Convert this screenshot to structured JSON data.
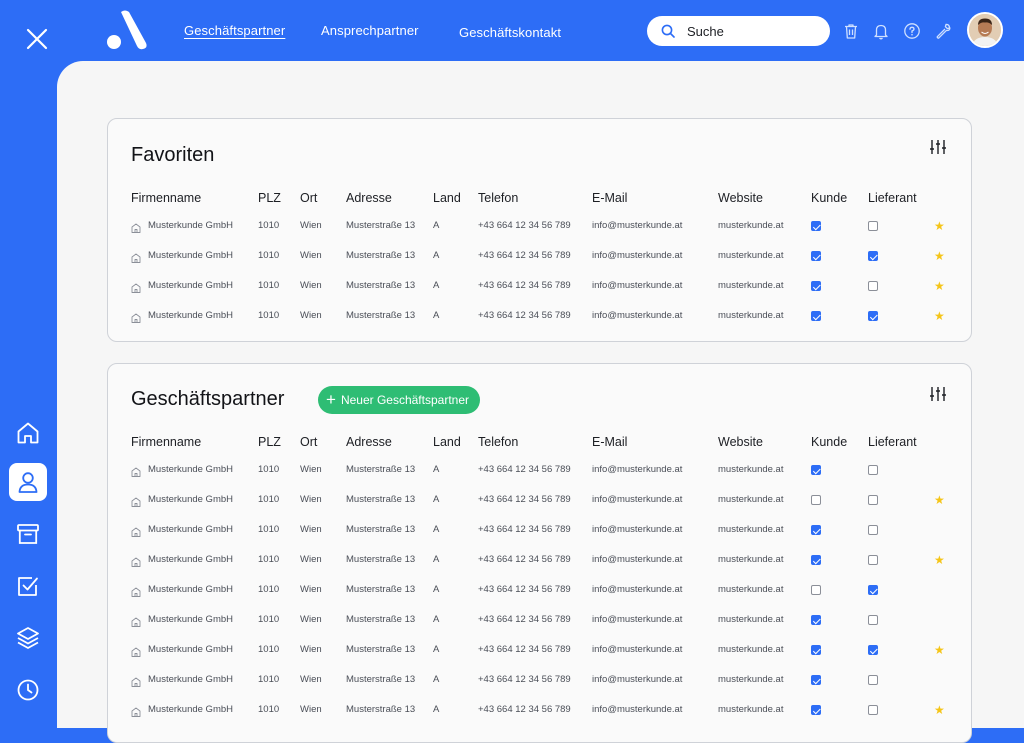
{
  "nav": {
    "links": [
      "Geschäftspartner",
      "Ansprechpartner",
      "Geschäftskontakt"
    ],
    "active": "Geschäftspartner",
    "search_placeholder": "Suche",
    "icons": [
      "trash-icon",
      "bell-icon",
      "help-icon",
      "wrench-icon"
    ]
  },
  "sidebar": {
    "items": [
      "home-icon",
      "user-icon",
      "archive-icon",
      "checkbox-icon",
      "layers-icon",
      "clock-icon"
    ],
    "active": "user-icon"
  },
  "columns": [
    "Firmenname",
    "PLZ",
    "Ort",
    "Adresse",
    "Land",
    "Telefon",
    "E-Mail",
    "Website",
    "Kunde",
    "Lieferant"
  ],
  "favorites": {
    "title": "Favoriten",
    "rows": [
      {
        "name": "Musterkunde GmbH",
        "plz": "1010",
        "ort": "Wien",
        "adresse": "Musterstraße 13",
        "land": "A",
        "telefon": "+43 664 12 34 56 789",
        "email": "info@musterkunde.at",
        "website": "musterkunde.at",
        "kunde": true,
        "lieferant": false,
        "fav": true
      },
      {
        "name": "Musterkunde GmbH",
        "plz": "1010",
        "ort": "Wien",
        "adresse": "Musterstraße 13",
        "land": "A",
        "telefon": "+43 664 12 34 56 789",
        "email": "info@musterkunde.at",
        "website": "musterkunde.at",
        "kunde": true,
        "lieferant": true,
        "fav": true
      },
      {
        "name": "Musterkunde GmbH",
        "plz": "1010",
        "ort": "Wien",
        "adresse": "Musterstraße 13",
        "land": "A",
        "telefon": "+43 664 12 34 56 789",
        "email": "info@musterkunde.at",
        "website": "musterkunde.at",
        "kunde": true,
        "lieferant": false,
        "fav": true
      },
      {
        "name": "Musterkunde GmbH",
        "plz": "1010",
        "ort": "Wien",
        "adresse": "Musterstraße 13",
        "land": "A",
        "telefon": "+43 664 12 34 56 789",
        "email": "info@musterkunde.at",
        "website": "musterkunde.at",
        "kunde": true,
        "lieferant": true,
        "fav": true
      }
    ]
  },
  "partners": {
    "title": "Geschäftspartner",
    "add_label": "Neuer Geschäftspartner",
    "rows": [
      {
        "name": "Musterkunde GmbH",
        "plz": "1010",
        "ort": "Wien",
        "adresse": "Musterstraße 13",
        "land": "A",
        "telefon": "+43 664 12 34 56 789",
        "email": "info@musterkunde.at",
        "website": "musterkunde.at",
        "kunde": true,
        "lieferant": false,
        "fav": false
      },
      {
        "name": "Musterkunde GmbH",
        "plz": "1010",
        "ort": "Wien",
        "adresse": "Musterstraße 13",
        "land": "A",
        "telefon": "+43 664 12 34 56 789",
        "email": "info@musterkunde.at",
        "website": "musterkunde.at",
        "kunde": false,
        "lieferant": false,
        "fav": true
      },
      {
        "name": "Musterkunde GmbH",
        "plz": "1010",
        "ort": "Wien",
        "adresse": "Musterstraße 13",
        "land": "A",
        "telefon": "+43 664 12 34 56 789",
        "email": "info@musterkunde.at",
        "website": "musterkunde.at",
        "kunde": true,
        "lieferant": false,
        "fav": false
      },
      {
        "name": "Musterkunde GmbH",
        "plz": "1010",
        "ort": "Wien",
        "adresse": "Musterstraße 13",
        "land": "A",
        "telefon": "+43 664 12 34 56 789",
        "email": "info@musterkunde.at",
        "website": "musterkunde.at",
        "kunde": true,
        "lieferant": false,
        "fav": true
      },
      {
        "name": "Musterkunde GmbH",
        "plz": "1010",
        "ort": "Wien",
        "adresse": "Musterstraße 13",
        "land": "A",
        "telefon": "+43 664 12 34 56 789",
        "email": "info@musterkunde.at",
        "website": "musterkunde.at",
        "kunde": false,
        "lieferant": true,
        "fav": false
      },
      {
        "name": "Musterkunde GmbH",
        "plz": "1010",
        "ort": "Wien",
        "adresse": "Musterstraße 13",
        "land": "A",
        "telefon": "+43 664 12 34 56 789",
        "email": "info@musterkunde.at",
        "website": "musterkunde.at",
        "kunde": true,
        "lieferant": false,
        "fav": false
      },
      {
        "name": "Musterkunde GmbH",
        "plz": "1010",
        "ort": "Wien",
        "adresse": "Musterstraße 13",
        "land": "A",
        "telefon": "+43 664 12 34 56 789",
        "email": "info@musterkunde.at",
        "website": "musterkunde.at",
        "kunde": true,
        "lieferant": true,
        "fav": true
      },
      {
        "name": "Musterkunde GmbH",
        "plz": "1010",
        "ort": "Wien",
        "adresse": "Musterstraße 13",
        "land": "A",
        "telefon": "+43 664 12 34 56 789",
        "email": "info@musterkunde.at",
        "website": "musterkunde.at",
        "kunde": true,
        "lieferant": false,
        "fav": false
      },
      {
        "name": "Musterkunde GmbH",
        "plz": "1010",
        "ort": "Wien",
        "adresse": "Musterstraße 13",
        "land": "A",
        "telefon": "+43 664 12 34 56 789",
        "email": "info@musterkunde.at",
        "website": "musterkunde.at",
        "kunde": true,
        "lieferant": false,
        "fav": true
      }
    ]
  },
  "colors": {
    "brand": "#2d6df6",
    "add_button": "#2ebd74",
    "star": "#f5c518"
  }
}
